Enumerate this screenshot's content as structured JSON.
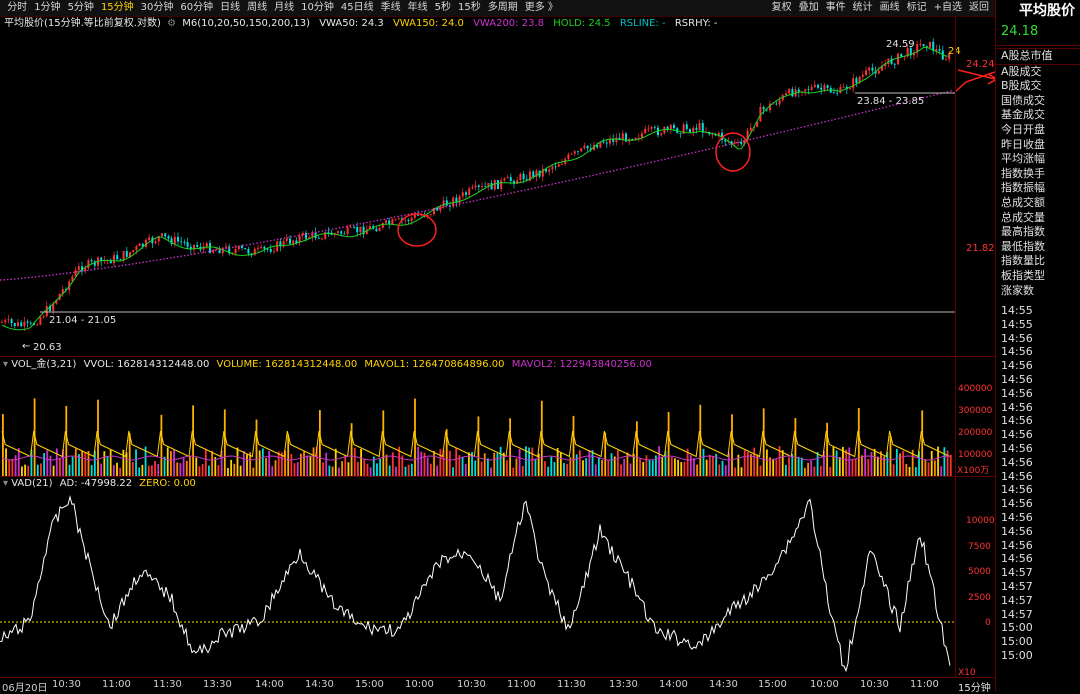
{
  "toolbar": {
    "periods": [
      "分时",
      "1分钟",
      "5分钟",
      "15分钟",
      "30分钟",
      "60分钟",
      "日线",
      "周线",
      "月线",
      "10分钟",
      "45日线",
      "季线",
      "年线",
      "5秒",
      "15秒",
      "多周期",
      "更多 》"
    ],
    "active_period": "15分钟",
    "right_tools": [
      "复权",
      "叠加",
      "事件",
      "统计",
      "画线",
      "标记",
      "+自选",
      "返回"
    ]
  },
  "main_header": {
    "title": "平均股价(15分钟.等比前复权.对数)",
    "m6": "M6(10,20,50,150,200,13)",
    "vwa50": "VWA50: 24.3",
    "vwa150": "VWA150: 24.0",
    "vwa200": "VWA200: 23.8",
    "hold": "HOLD: 24.5",
    "rsline": "RSLINE: -",
    "rsrhy": "RSRHY: -"
  },
  "main_annotations": {
    "high": "24.59",
    "range_top": "23.84 - 23.85",
    "range_low": "21.04 - 21.05",
    "low": "20.63",
    "price_marker": "24.24",
    "axis_label": "21.82",
    "last_value": "24"
  },
  "volume_header": {
    "name": "VOL_金(3,21)",
    "vvol": "VVOL: 162814312448.00",
    "volume": "VOLUME: 162814312448.00",
    "mavol1": "MAVOL1: 126470864896.00",
    "mavol2": "MAVOL2: 122943840256.00"
  },
  "volume_axis": [
    "400000",
    "300000",
    "200000",
    "100000"
  ],
  "volume_unit": "X100万",
  "vad_header": {
    "name": "VAD(21)",
    "ad": "AD: -47998.22",
    "zero": "ZERO: 0.00"
  },
  "vad_axis": [
    "10000",
    "7500",
    "5000",
    "2500",
    "0"
  ],
  "vad_unit": "X10",
  "x_axis": [
    "06月20日",
    "10:30",
    "11:00",
    "11:30",
    "13:30",
    "14:00",
    "14:30",
    "15:00",
    "10:00",
    "10:30",
    "11:00",
    "11:30",
    "13:30",
    "14:00",
    "14:30",
    "15:00",
    "10:00",
    "10:30",
    "11:00"
  ],
  "period_label": "15分钟",
  "side_panel": {
    "title": "平均股价",
    "price": "24.18",
    "items": [
      "A股总市值",
      "A股成交",
      "B股成交",
      "国债成交",
      "基金成交",
      "今日开盘",
      "昨日收盘",
      "平均涨幅",
      "指数换手",
      "指数振幅",
      "总成交额",
      "总成交量",
      "最高指数",
      "最低指数",
      "指数量比",
      "板指类型",
      "涨家数"
    ],
    "times": [
      "14:55",
      "14:55",
      "14:56",
      "14:56",
      "14:56",
      "14:56",
      "14:56",
      "14:56",
      "14:56",
      "14:56",
      "14:56",
      "14:56",
      "14:56",
      "14:56",
      "14:56",
      "14:56",
      "14:56",
      "14:56",
      "14:56",
      "14:57",
      "14:57",
      "14:57",
      "14:57",
      "15:00",
      "15:00",
      "15:00"
    ]
  },
  "colors": {
    "up": "#ff3232",
    "down": "#00e0e0",
    "ma_green": "#1fd21f",
    "vwa_purple": "#cc33cc",
    "accent_yellow": "#ffd200",
    "circle": "#ff2020"
  }
}
